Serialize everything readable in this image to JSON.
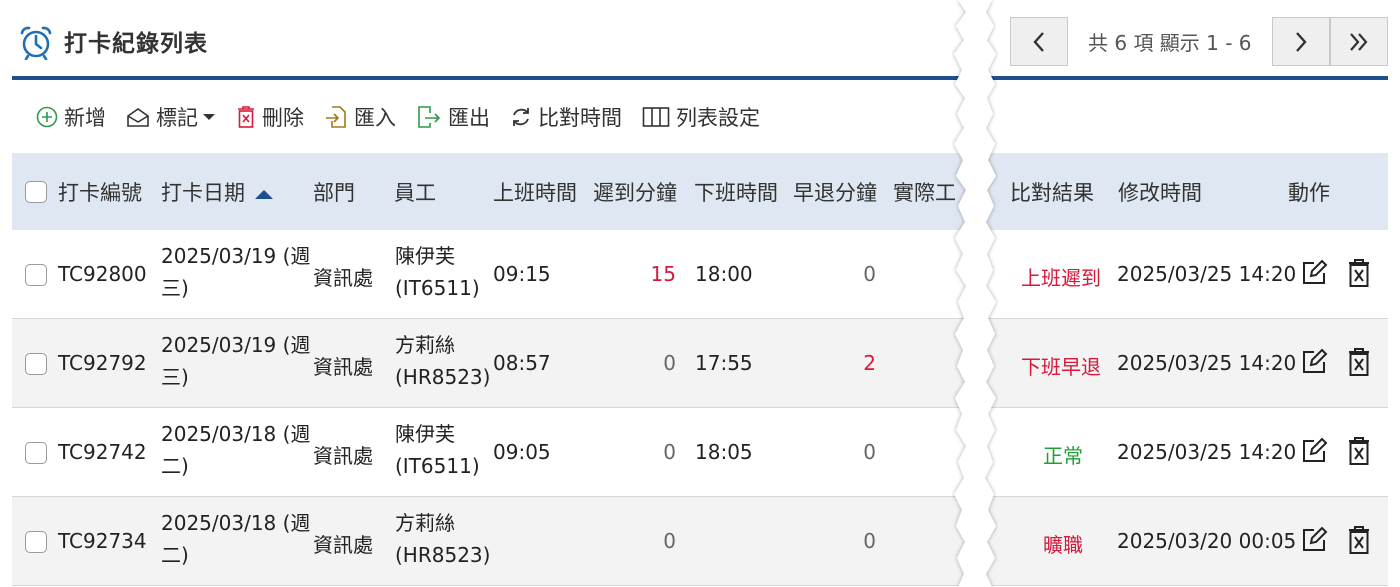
{
  "header": {
    "title": "打卡紀錄列表",
    "icon": "alarm-clock-icon"
  },
  "pager": {
    "info": "共 6 項 顯示 1 - 6",
    "prev_icon": "chevron-left-icon",
    "next_icon": "chevron-right-icon",
    "last_icon": "double-chevron-right-icon"
  },
  "toolbar": {
    "add": "新增",
    "mark": "標記",
    "delete": "刪除",
    "import": "匯入",
    "export": "匯出",
    "compare": "比對時間",
    "columns": "列表設定"
  },
  "table": {
    "headers": {
      "id": "打卡編號",
      "date": "打卡日期",
      "dept": "部門",
      "employee": "員工",
      "in_time": "上班時間",
      "late_min": "遲到分鐘",
      "out_time": "下班時間",
      "early_min": "早退分鐘",
      "actual": "實際工",
      "result": "比對結果",
      "modified": "修改時間",
      "actions": "動作"
    },
    "sort": {
      "column": "打卡日期",
      "direction": "asc"
    },
    "rows": [
      {
        "id": "TC92800",
        "date_line1": "2025/03/19 (週",
        "date_line2": "三)",
        "dept": "資訊處",
        "emp_name": "陳伊芙",
        "emp_code": "(IT6511)",
        "in_time": "09:15",
        "late": "15",
        "out_time": "18:00",
        "early": "0",
        "result": "上班遲到",
        "modified": "2025/03/25 14:20"
      },
      {
        "id": "TC92792",
        "date_line1": "2025/03/19 (週",
        "date_line2": "三)",
        "dept": "資訊處",
        "emp_name": "方莉絲",
        "emp_code": "(HR8523)",
        "in_time": "08:57",
        "late": "0",
        "out_time": "17:55",
        "early": "2",
        "result": "下班早退",
        "modified": "2025/03/25 14:20"
      },
      {
        "id": "TC92742",
        "date_line1": "2025/03/18 (週",
        "date_line2": "二)",
        "dept": "資訊處",
        "emp_name": "陳伊芙",
        "emp_code": "(IT6511)",
        "in_time": "09:05",
        "late": "0",
        "out_time": "18:05",
        "early": "0",
        "result": "正常",
        "modified": "2025/03/25 14:20"
      },
      {
        "id": "TC92734",
        "date_line1": "2025/03/18 (週",
        "date_line2": "二)",
        "dept": "資訊處",
        "emp_name": "方莉絲",
        "emp_code": "(HR8523)",
        "in_time": "",
        "late": "0",
        "out_time": "",
        "early": "0",
        "result": "曠職",
        "modified": "2025/03/20 00:05"
      }
    ]
  },
  "colors": {
    "accent": "#1f4f8f",
    "header_bg": "#dfe7f2",
    "red": "#d7193c",
    "green": "#22a035"
  }
}
